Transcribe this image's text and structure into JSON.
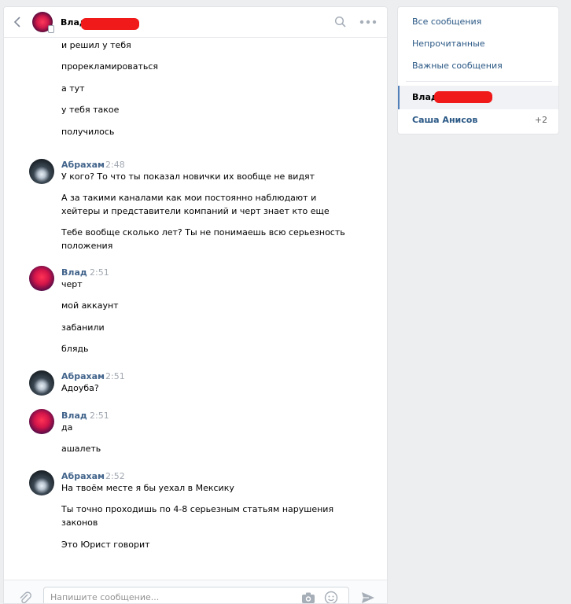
{
  "header": {
    "name": "Влад"
  },
  "messages": {
    "block0": [
      "и решил у тебя",
      "прорекламироваться",
      "а тут",
      "у тебя такое",
      "получилось"
    ],
    "block1": {
      "author": "Абрахам",
      "time": "2:48",
      "lines": [
        "У кого? То что ты показал новички их вообще не видят",
        "А за такими каналами как мои постоянно наблюдают и",
        "хейтеры и представители компаний и черт знает кто еще",
        "Тебе вообще сколько лет? Ты не понимаешь всю серьезность",
        "положения"
      ]
    },
    "block2": {
      "author": "Влад",
      "time": "2:51",
      "lines": [
        "черт",
        "мой аккаунт",
        "забанили",
        "блядь"
      ]
    },
    "block3": {
      "author": "Абрахам",
      "time": "2:51",
      "lines": [
        "Адоуба?"
      ]
    },
    "block4": {
      "author": "Влад",
      "time": "2:51",
      "lines": [
        "да",
        "ашалеть"
      ]
    },
    "block5": {
      "author": "Абрахам",
      "time": "2:52",
      "lines": [
        "На твоём месте я бы уехал в Мексику",
        "Ты точно проходишь по 4-8 серьезным статьям нарушения",
        "законов",
        "Это Юрист говорит"
      ]
    }
  },
  "composer": {
    "placeholder": "Напишите сообщение..."
  },
  "sidebar": {
    "all": "Все сообщения",
    "unread": "Непрочитанные",
    "important": "Важные сообщения",
    "active_chat": "Влад",
    "other_chat": "Саша Анисов",
    "other_count": "+2"
  },
  "colors": {
    "link": "#2a5885",
    "author": "#42648b",
    "redaction": "#f01a1a"
  }
}
